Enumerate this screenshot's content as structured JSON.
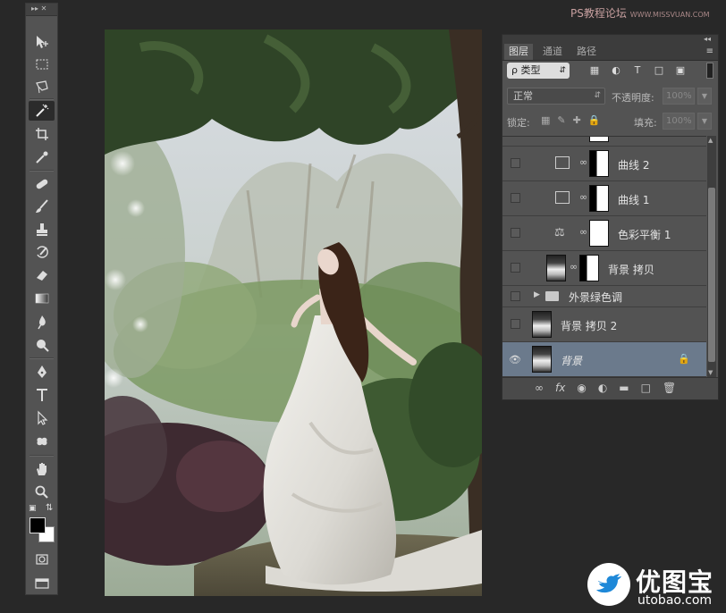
{
  "app": {
    "toolbar_header": "▸▸ ✕",
    "tools": [
      {
        "name": "move-tool-icon",
        "active": false
      },
      {
        "name": "marquee-tool-icon",
        "active": false
      },
      {
        "name": "lasso-tool-icon",
        "active": false
      },
      {
        "name": "magic-wand-tool-icon",
        "active": true
      },
      {
        "name": "crop-tool-icon",
        "active": false
      },
      {
        "name": "eyedropper-tool-icon",
        "active": false
      },
      {
        "name": "healing-brush-tool-icon",
        "active": false
      },
      {
        "name": "brush-tool-icon",
        "active": false
      },
      {
        "name": "clone-stamp-tool-icon",
        "active": false
      },
      {
        "name": "history-brush-tool-icon",
        "active": false
      },
      {
        "name": "eraser-tool-icon",
        "active": false
      },
      {
        "name": "gradient-tool-icon",
        "active": false
      },
      {
        "name": "blur-tool-icon",
        "active": false
      },
      {
        "name": "dodge-tool-icon",
        "active": false
      },
      {
        "name": "pen-tool-icon",
        "active": false
      },
      {
        "name": "type-tool-icon",
        "active": false
      },
      {
        "name": "path-selection-tool-icon",
        "active": false
      },
      {
        "name": "custom-shape-tool-icon",
        "active": false
      },
      {
        "name": "hand-tool-icon",
        "active": false
      },
      {
        "name": "zoom-tool-icon",
        "active": false
      }
    ],
    "foreground_color": "#000000",
    "background_color": "#ffffff"
  },
  "watermark_top": {
    "cn": "PS教程论坛",
    "en": "WWW.MISSVUAN.COM"
  },
  "layers_panel": {
    "collapse_label": "◂◂",
    "tabs": [
      {
        "label": "图层",
        "active": true
      },
      {
        "label": "通道",
        "active": false
      },
      {
        "label": "路径",
        "active": false
      }
    ],
    "menu_icon": "≡",
    "filter_label": "ρ 类型",
    "blend_mode": "正常",
    "opacity_label": "不透明度:",
    "opacity_value": "100%",
    "lock_label": "锁定:",
    "fill_label": "填充:",
    "fill_value": "100%",
    "layers": [
      {
        "name": "曲线 2",
        "type": "curves",
        "visible": false,
        "selected": false
      },
      {
        "name": "曲线 1",
        "type": "curves",
        "visible": false,
        "selected": false
      },
      {
        "name": "色彩平衡 1",
        "type": "color-balance",
        "visible": false,
        "selected": false
      },
      {
        "name": "背景 拷贝",
        "type": "masked-pixel",
        "visible": false,
        "selected": false
      },
      {
        "name": "外景绿色调",
        "type": "group",
        "visible": false,
        "selected": false
      },
      {
        "name": "背景 拷贝 2",
        "type": "pixel",
        "visible": false,
        "selected": false
      },
      {
        "name": "背景",
        "type": "background",
        "visible": true,
        "selected": true
      }
    ]
  },
  "logo": {
    "title": "优图宝",
    "url": "utobao.com"
  }
}
